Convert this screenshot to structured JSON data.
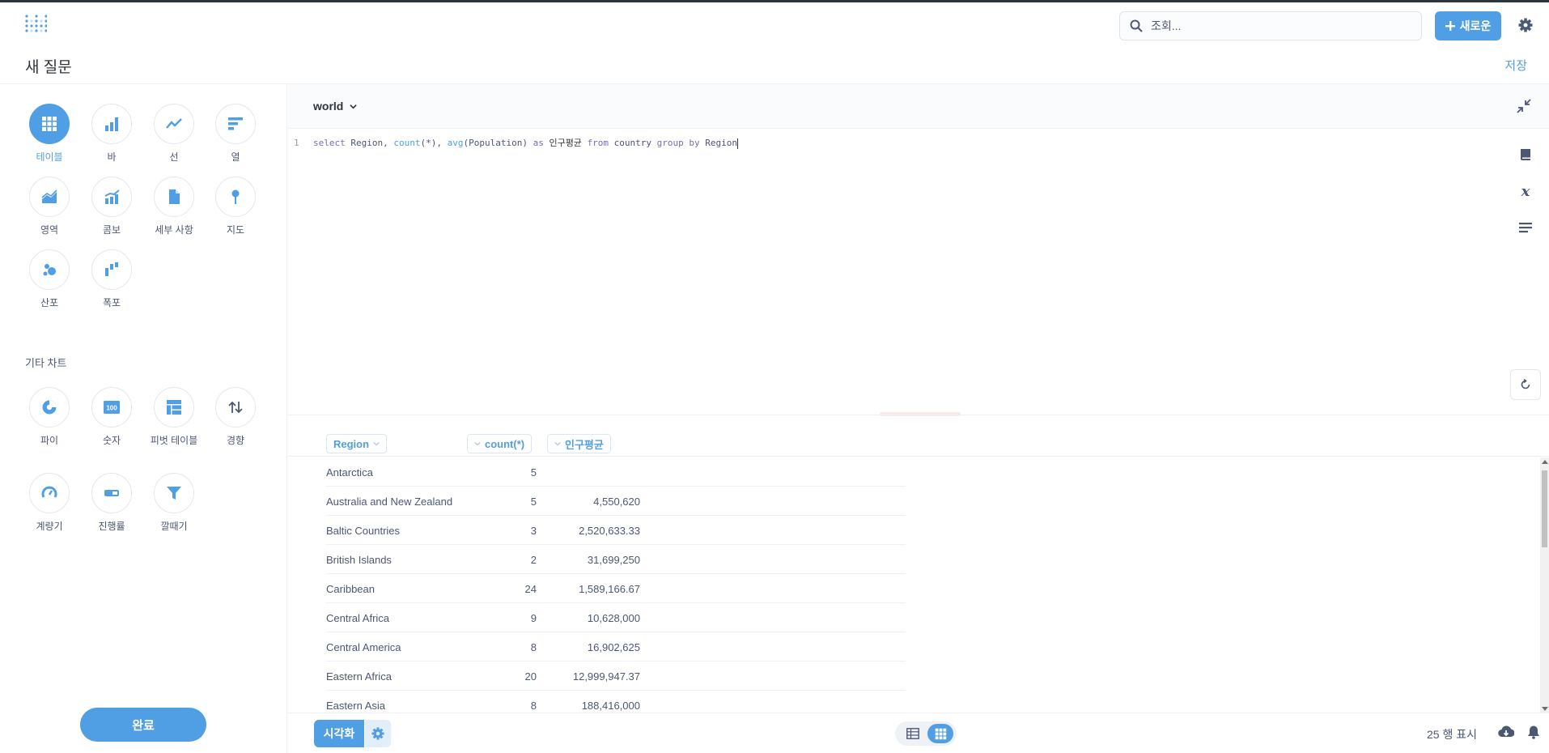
{
  "topbar": {
    "search_placeholder": "조회...",
    "new_button_label": "새로운"
  },
  "header": {
    "title": "새 질문",
    "save_label": "저장"
  },
  "sidebar": {
    "charts": [
      {
        "label": "테이블",
        "icon": "table-icon",
        "selected": true
      },
      {
        "label": "바",
        "icon": "bar-chart-icon"
      },
      {
        "label": "선",
        "icon": "line-chart-icon"
      },
      {
        "label": "열",
        "icon": "row-chart-icon"
      },
      {
        "label": "영역",
        "icon": "area-chart-icon"
      },
      {
        "label": "콤보",
        "icon": "combo-chart-icon"
      },
      {
        "label": "세부 사항",
        "icon": "document-icon"
      },
      {
        "label": "지도",
        "icon": "pin-icon"
      },
      {
        "label": "산포",
        "icon": "scatter-icon"
      },
      {
        "label": "폭포",
        "icon": "waterfall-icon"
      }
    ],
    "other_title": "기타 차트",
    "other_charts": [
      {
        "label": "파이",
        "icon": "pie-icon"
      },
      {
        "label": "숫자",
        "icon": "number-100-icon"
      },
      {
        "label": "피벗 테이블",
        "icon": "pivot-icon"
      },
      {
        "label": "경향",
        "icon": "trend-icon"
      },
      {
        "label": "계량기",
        "icon": "gauge-icon"
      },
      {
        "label": "진행률",
        "icon": "progress-icon"
      },
      {
        "label": "깔때기",
        "icon": "funnel-icon"
      }
    ],
    "done_label": "완료"
  },
  "editor": {
    "database": "world",
    "line_number": "1",
    "query": {
      "t1": "select",
      "t2": " Region, ",
      "t3": "count",
      "t4": "(*), ",
      "t5": "avg",
      "t6": "(Population) ",
      "t7": "as",
      "t8": " 인구평균 ",
      "t9": "from",
      "t10": " country ",
      "t11": "group by",
      "t12": " Region"
    }
  },
  "results": {
    "columns": [
      "Region",
      "count(*)",
      "인구평균"
    ],
    "rows": [
      {
        "region": "Antarctica",
        "count": "5",
        "avg": ""
      },
      {
        "region": "Australia and New Zealand",
        "count": "5",
        "avg": "4,550,620"
      },
      {
        "region": "Baltic Countries",
        "count": "3",
        "avg": "2,520,633.33"
      },
      {
        "region": "British Islands",
        "count": "2",
        "avg": "31,699,250"
      },
      {
        "region": "Caribbean",
        "count": "24",
        "avg": "1,589,166.67"
      },
      {
        "region": "Central Africa",
        "count": "9",
        "avg": "10,628,000"
      },
      {
        "region": "Central America",
        "count": "8",
        "avg": "16,902,625"
      },
      {
        "region": "Eastern Africa",
        "count": "20",
        "avg": "12,999,947.37"
      },
      {
        "region": "Eastern Asia",
        "count": "8",
        "avg": "188,416,000"
      }
    ]
  },
  "footer": {
    "visualize_label": "시각화",
    "row_count": "25 행 표시"
  },
  "colors": {
    "brand": "#509ee3",
    "text": "#4c5773",
    "border": "#eef0f3"
  }
}
